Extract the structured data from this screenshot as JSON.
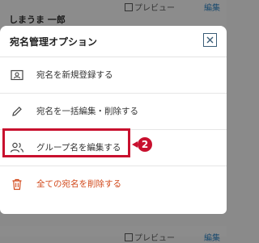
{
  "background": {
    "recipient_name": "しまうま 一郎",
    "preview_label": "プレビュー",
    "edit_label": "編集"
  },
  "sheet": {
    "title": "宛名管理オプション",
    "close_icon": "close-icon"
  },
  "menu": {
    "items": [
      {
        "label": "宛名を新規登録する",
        "icon": "address-card-icon"
      },
      {
        "label": "宛名を一括編集・削除する",
        "icon": "pencil-icon"
      },
      {
        "label": "グループ名を編集する",
        "icon": "group-icon"
      },
      {
        "label": "全ての宛名を削除する",
        "icon": "trash-icon",
        "color": "#d24a1c"
      }
    ]
  },
  "callout": {
    "number": "2",
    "color": "#c8102e"
  }
}
